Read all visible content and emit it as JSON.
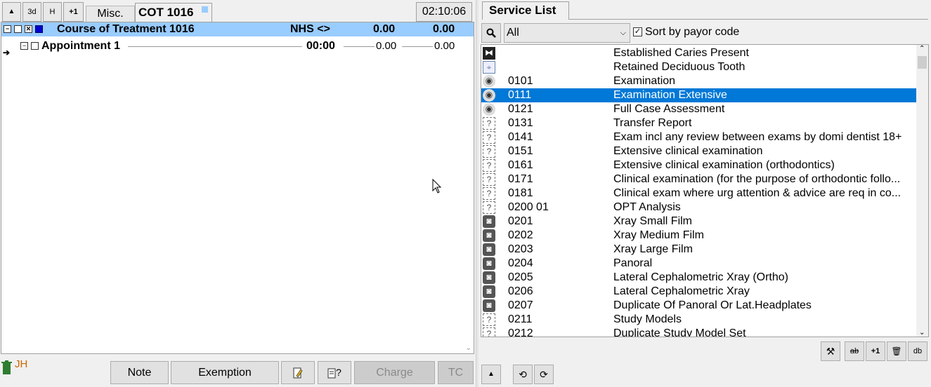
{
  "left": {
    "toolbar": {
      "up_label": "▲",
      "threed_label": "3d",
      "h_label": "H",
      "plus1_label": "+1",
      "misc_tab": "Misc.",
      "cot_tab": "COT 1016",
      "timer": "02:10:06"
    },
    "course": {
      "title": "Course of Treatment 1016",
      "payor": "NHS <>",
      "value1": "0.00",
      "value2": "0.00"
    },
    "appointment": {
      "title": "Appointment 1",
      "time": "00:00",
      "value1": "0.00",
      "value2": "0.00"
    },
    "footer": {
      "initials": "JH",
      "note": "Note",
      "exemption": "Exemption",
      "form_q": "?",
      "charge": "Charge",
      "tc": "TC"
    }
  },
  "right": {
    "tab": "Service List",
    "filter": {
      "selected": "All",
      "sort_label": "Sort by payor code"
    },
    "services": [
      {
        "icon": "caries-icon",
        "code": "",
        "desc": "Established Caries Present"
      },
      {
        "icon": "tooth-icon",
        "code": "",
        "desc": "Retained Deciduous Tooth"
      },
      {
        "icon": "eye-icon",
        "code": "0101",
        "desc": "Examination"
      },
      {
        "icon": "eye-icon",
        "code": "0111",
        "desc": "Examination Extensive"
      },
      {
        "icon": "eye-icon",
        "code": "0121",
        "desc": "Full Case Assessment"
      },
      {
        "icon": "unknown-icon",
        "code": "0131",
        "desc": "Transfer Report"
      },
      {
        "icon": "unknown-icon",
        "code": "0141",
        "desc": "Exam incl any review between exams by domi dentist 18+"
      },
      {
        "icon": "unknown-icon",
        "code": "0151",
        "desc": "Extensive clinical examination"
      },
      {
        "icon": "unknown-icon",
        "code": "0161",
        "desc": "Extensive clinical examination (orthodontics)"
      },
      {
        "icon": "unknown-icon",
        "code": "0171",
        "desc": "Clinical examination (for the purpose of orthodontic follo..."
      },
      {
        "icon": "unknown-icon",
        "code": "0181",
        "desc": "Clinical exam where urg attention & advice are req in co..."
      },
      {
        "icon": "unknown-icon",
        "code": "0200 01",
        "desc": "OPT Analysis"
      },
      {
        "icon": "camera-icon",
        "code": "0201",
        "desc": "Xray Small Film"
      },
      {
        "icon": "camera-icon",
        "code": "0202",
        "desc": "Xray Medium Film"
      },
      {
        "icon": "camera-icon",
        "code": "0203",
        "desc": "Xray Large Film"
      },
      {
        "icon": "camera-icon",
        "code": "0204",
        "desc": "Panoral"
      },
      {
        "icon": "camera-icon",
        "code": "0205",
        "desc": "Lateral Cephalometric Xray (Ortho)"
      },
      {
        "icon": "camera-icon",
        "code": "0206",
        "desc": "Lateral Cephalometric Xray"
      },
      {
        "icon": "camera-icon",
        "code": "0207",
        "desc": "Duplicate Of Panoral Or Lat.Headplates"
      },
      {
        "icon": "unknown-icon",
        "code": "0211",
        "desc": "Study Models"
      },
      {
        "icon": "unknown-icon",
        "code": "0212",
        "desc": "Duplicate Study Model Set"
      }
    ],
    "selected_index": 3,
    "bottom_right": {
      "pin_label": "⚒",
      "split_label": "ab",
      "plus1_label": "+1",
      "delete_label": "🗑",
      "db_label": "db"
    },
    "bottom_left": {
      "up_label": "▲",
      "undo_label": "⟲",
      "redo_label": "⟳"
    }
  },
  "colors": {
    "course_bar": "#99ccff",
    "selection": "#0078d7",
    "trash": "#2e7d32",
    "initials": "#cc6600"
  }
}
